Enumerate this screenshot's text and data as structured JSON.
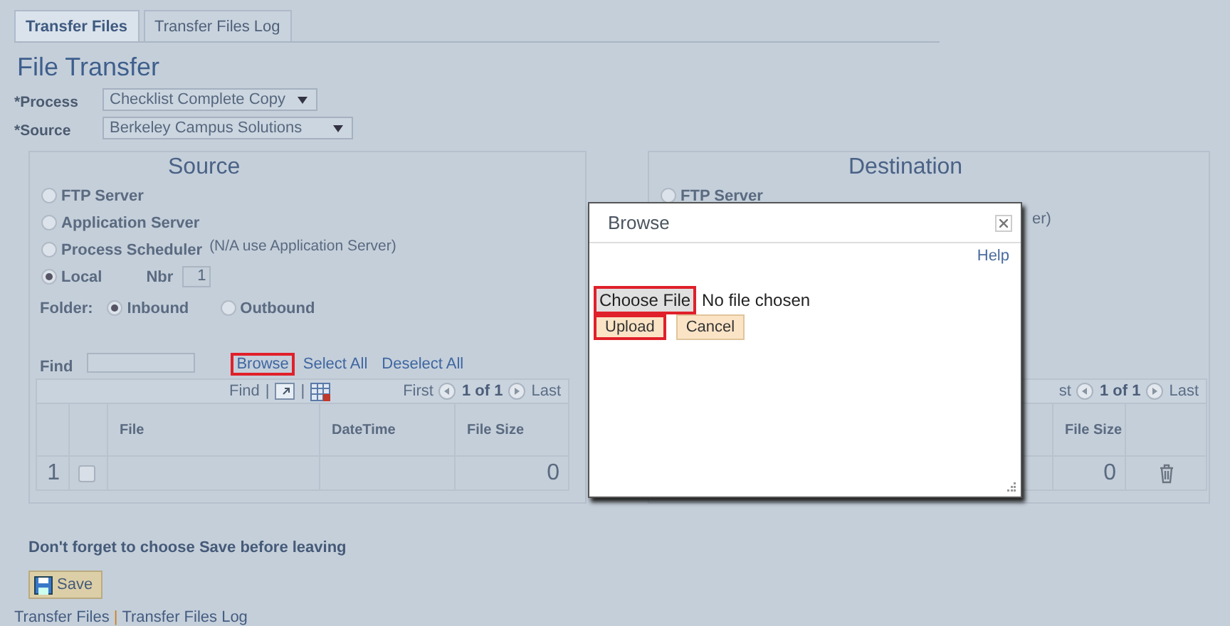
{
  "tabs": [
    {
      "label": "Transfer Files",
      "selected": true
    },
    {
      "label": "Transfer Files Log",
      "selected": false
    }
  ],
  "page_title": "File Transfer",
  "fields": [
    {
      "label": "*Process",
      "value": "Checklist Complete Copy"
    },
    {
      "label": "*Source",
      "value": "Berkeley Campus Solutions"
    }
  ],
  "source": {
    "title": "Source",
    "locations": [
      {
        "label": "FTP Server",
        "selected": false
      },
      {
        "label": "Application Server",
        "selected": false
      },
      {
        "label": "Process Scheduler",
        "note": "(N/A use Application Server)",
        "selected": false
      },
      {
        "label": "Local",
        "selected": true,
        "nbr_label": "Nbr",
        "nbr_value": "1"
      }
    ],
    "folder_label": "Folder:",
    "folders": [
      {
        "label": "Inbound",
        "selected": true
      },
      {
        "label": "Outbound",
        "selected": false
      }
    ],
    "find_label": "Find",
    "actions": [
      {
        "label": "Browse",
        "highlighted": true
      },
      {
        "label": "Select All",
        "highlighted": false
      },
      {
        "label": "Deselect All",
        "highlighted": false
      }
    ],
    "grid": {
      "toolbar": {
        "find": "Find",
        "separators": [
          "|",
          "|"
        ],
        "first": "First",
        "range": "1 of 1",
        "last": "Last"
      },
      "columns": [
        "File",
        "DateTime",
        "File Size"
      ],
      "rows": [
        {
          "number": "1",
          "checked": false,
          "file_size": "0"
        }
      ]
    }
  },
  "destination": {
    "title": "Destination",
    "locations": [
      {
        "label": "FTP Server",
        "selected": false
      }
    ],
    "fragment": "er)",
    "grid": {
      "toolbar": {
        "first": "st",
        "range": "1 of 1",
        "last": "Last"
      },
      "columns": [
        "File Size"
      ],
      "rows": [
        {
          "file_size": "0"
        }
      ]
    }
  },
  "reminder": "Don't forget to choose Save before leaving",
  "save_button": "Save",
  "footer_links": [
    "Transfer Files",
    "Transfer Files Log"
  ],
  "footer_separator": "|",
  "dialog": {
    "title": "Browse",
    "help": "Help",
    "choose_file": {
      "label": "Choose File",
      "highlighted": true
    },
    "file_status": "No file chosen",
    "buttons": [
      {
        "label": "Upload",
        "highlighted": true
      },
      {
        "label": "Cancel",
        "highlighted": false
      }
    ]
  }
}
